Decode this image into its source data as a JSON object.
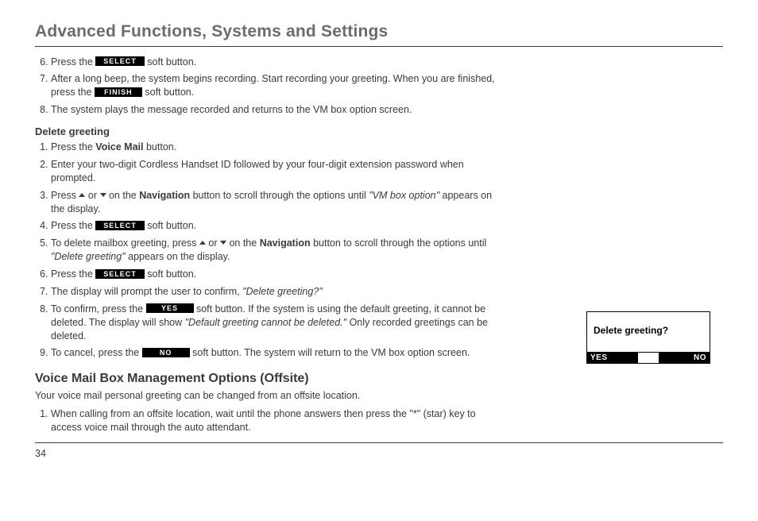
{
  "headline": "Advanced Functions, Systems and Settings",
  "softkeys": {
    "select": "SELECT",
    "finish": "FINISH",
    "yes": "YES",
    "no": "NO"
  },
  "record_steps": {
    "s6_a": "Press the ",
    "s6_b": " soft button.",
    "s7_a": "After a long beep, the system begins recording. Start recording your greeting. When you are finished, press the ",
    "s7_b": " soft button.",
    "s8": "The system plays the message recorded and returns to the VM box option screen."
  },
  "delete": {
    "heading": "Delete greeting",
    "s1_a": "Press the ",
    "s1_bold": "Voice Mail",
    "s1_b": " button.",
    "s2": "Enter your two-digit Cordless Handset ID followed by your four-digit extension password when prompted.",
    "s3_a": "Press ",
    "s3_mid": " or ",
    "s3_b": " on the ",
    "s3_bold": "Navigation",
    "s3_c": " button to scroll through the options until ",
    "s3_ital": "\"VM box option\"",
    "s3_d": " appears on the display.",
    "s4_a": "Press the ",
    "s4_b": " soft button.",
    "s5_a": "To delete mailbox greeting, press ",
    "s5_mid": " or ",
    "s5_b": " on the ",
    "s5_bold": "Navigation",
    "s5_c": " button to scroll through the options until  ",
    "s5_ital": "\"Delete greeting\"",
    "s5_d": " appears on the display.",
    "s6_a": "Press the ",
    "s6_b": " soft button.",
    "s7_a": "The display will prompt the user to confirm, ",
    "s7_ital": "\"Delete greeting?\"",
    "s8_a": "To confirm, press the ",
    "s8_b": " soft button. If the system is using the default greeting, it cannot be deleted. The display will show ",
    "s8_ital": "\"Default greeting cannot be deleted.\"",
    "s8_c": " Only recorded greetings can be deleted.",
    "s9_a": "To cancel, press the ",
    "s9_b": " soft button. The system will return to the VM box option screen."
  },
  "offsite": {
    "heading": "Voice Mail Box Management Options (Offsite)",
    "intro": "Your voice mail personal greeting can be changed from an offsite location.",
    "s1": "When calling from an offsite location, wait until the phone answers then press the  \"*\" (star) key to access voice mail through the auto attendant."
  },
  "lcd": {
    "prompt": "Delete greeting?",
    "left": "YES",
    "right": "NO"
  },
  "page_number": "34"
}
